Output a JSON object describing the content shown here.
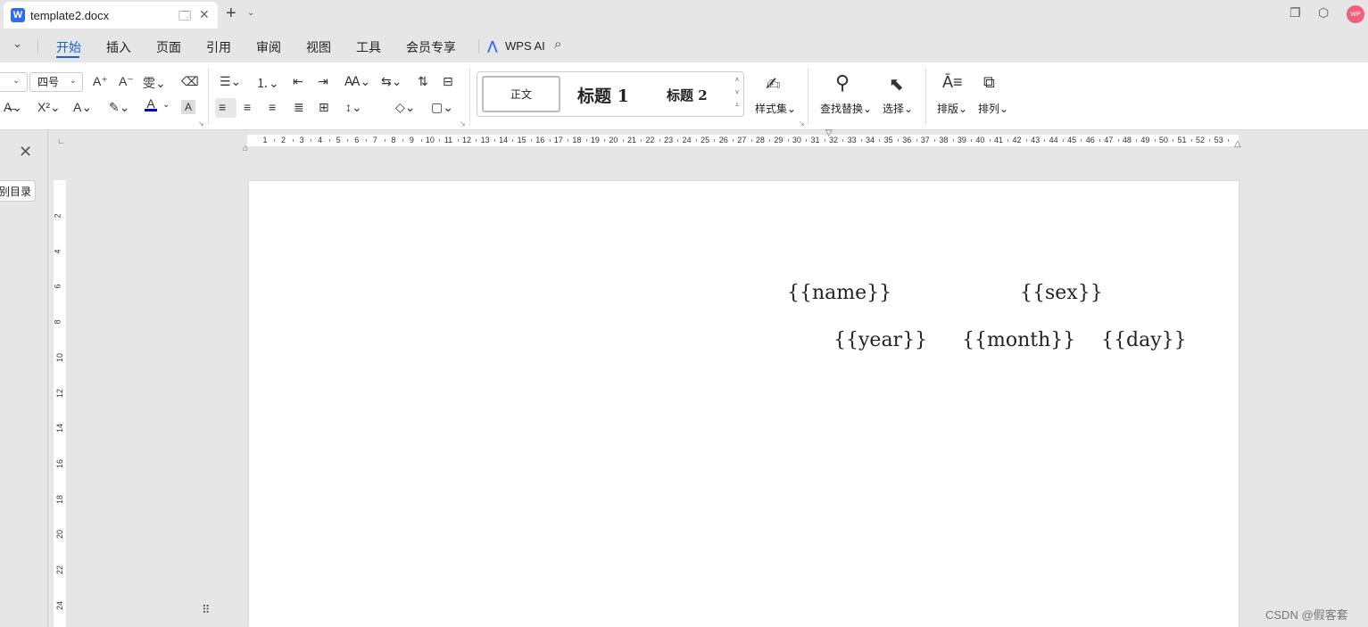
{
  "window": {
    "tab_title": "template2.docx",
    "app_icon_letter": "W",
    "avatar_text": "WP"
  },
  "menu": {
    "items": [
      "开始",
      "插入",
      "页面",
      "引用",
      "审阅",
      "视图",
      "工具",
      "会员专享"
    ],
    "active": "开始",
    "wps_ai_label": "WPS AI"
  },
  "ribbon": {
    "font_size": "四号",
    "styles": {
      "normal": "正文",
      "heading1": "标题 1",
      "heading2": "标题 2"
    },
    "style_set_label": "样式集",
    "find_replace_label": "查找替换",
    "select_label": "选择",
    "layout_label": "排版",
    "arrange_label": "排列"
  },
  "nav_pane": {
    "toc_button_label": "别目录"
  },
  "ruler": {
    "horizontal_numbers": [
      "1",
      "2",
      "3",
      "4",
      "5",
      "6",
      "7",
      "8",
      "9",
      "10",
      "11",
      "12",
      "13",
      "14",
      "15",
      "16",
      "17",
      "18",
      "19",
      "20",
      "21",
      "22",
      "23",
      "24",
      "25",
      "26",
      "27",
      "28",
      "29",
      "30",
      "31",
      "32",
      "33",
      "34",
      "35",
      "36",
      "37",
      "38",
      "39",
      "40",
      "41",
      "42",
      "43",
      "44",
      "45",
      "46",
      "47",
      "48",
      "49",
      "50",
      "51",
      "52",
      "53"
    ],
    "vertical_numbers": [
      "2",
      "4",
      "6",
      "8",
      "10",
      "12",
      "14",
      "16",
      "18",
      "20",
      "22",
      "24"
    ]
  },
  "document": {
    "fields": {
      "name": "{{name}}",
      "sex": "{{sex}}",
      "year": "{{year}}",
      "month": "{{month}}",
      "day": "{{day}}"
    }
  },
  "watermark": "CSDN @假客套",
  "colors": {
    "accent": "#1a5fd6",
    "avatar": "#f0607a",
    "font_color_bar": "#0000cc"
  }
}
